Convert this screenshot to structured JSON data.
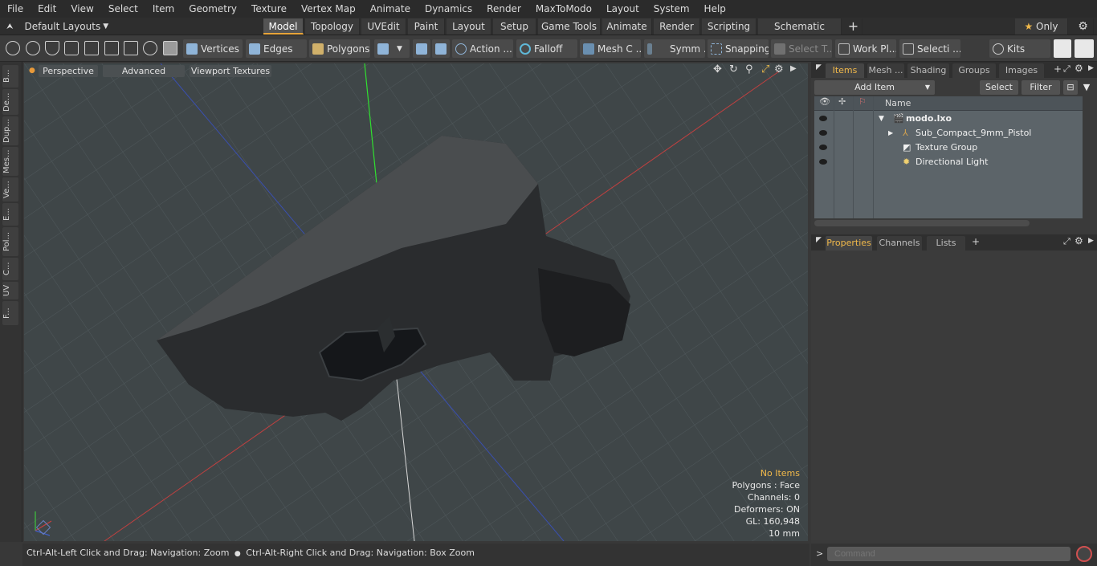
{
  "menu": [
    "File",
    "Edit",
    "View",
    "Select",
    "Item",
    "Geometry",
    "Texture",
    "Vertex Map",
    "Animate",
    "Dynamics",
    "Render",
    "MaxToModo",
    "Layout",
    "System",
    "Help"
  ],
  "layouts": {
    "label": "Default Layouts"
  },
  "tabs": [
    "Model",
    "Topology",
    "UVEdit",
    "Paint",
    "Layout",
    "Setup",
    "Game Tools",
    "Animate",
    "Render",
    "Scripting",
    "Schematic Fusion"
  ],
  "only_label": "Only",
  "toolbar": {
    "vertices": "Vertices",
    "edges": "Edges",
    "polygons": "Polygons",
    "action": "Action ...",
    "falloff": "Falloff",
    "mesh": "Mesh C ...",
    "symm": "Symm ...",
    "snapping": "Snapping",
    "select_t": "Select T...",
    "workpl": "Work Pl...",
    "selecti": "Selecti ...",
    "kits": "Kits"
  },
  "left_tabs": [
    "B...",
    "De...",
    "Dup...",
    "Mes...",
    "Ve...",
    "E...",
    "Pol...",
    "C...",
    "UV",
    "F..."
  ],
  "viewport": {
    "perspective": "Perspective",
    "advanced": "Advanced",
    "textures": "Viewport Textures",
    "stats": {
      "no_items": "No Items",
      "polygons": "Polygons : Face",
      "channels": "Channels: 0",
      "deformers": "Deformers: ON",
      "gl": "GL: 160,948",
      "scale": "10 mm"
    }
  },
  "statusbar": {
    "left": "Ctrl-Alt-Left Click and Drag: Navigation: Zoom",
    "right": "Ctrl-Alt-Right Click and Drag: Navigation: Box Zoom"
  },
  "items_panel": {
    "tabs": [
      "Items",
      "Mesh ...",
      "Shading",
      "Groups",
      "Images"
    ],
    "add_item": "Add Item",
    "select": "Select",
    "filter": "Filter",
    "name_header": "Name",
    "rows": [
      {
        "label": "modo.lxo"
      },
      {
        "label": "Sub_Compact_9mm_Pistol"
      },
      {
        "label": "Texture Group"
      },
      {
        "label": "Directional Light"
      }
    ]
  },
  "properties_panel": {
    "tabs": [
      "Properties",
      "Channels",
      "Lists"
    ]
  },
  "command": {
    "placeholder": "Command"
  }
}
